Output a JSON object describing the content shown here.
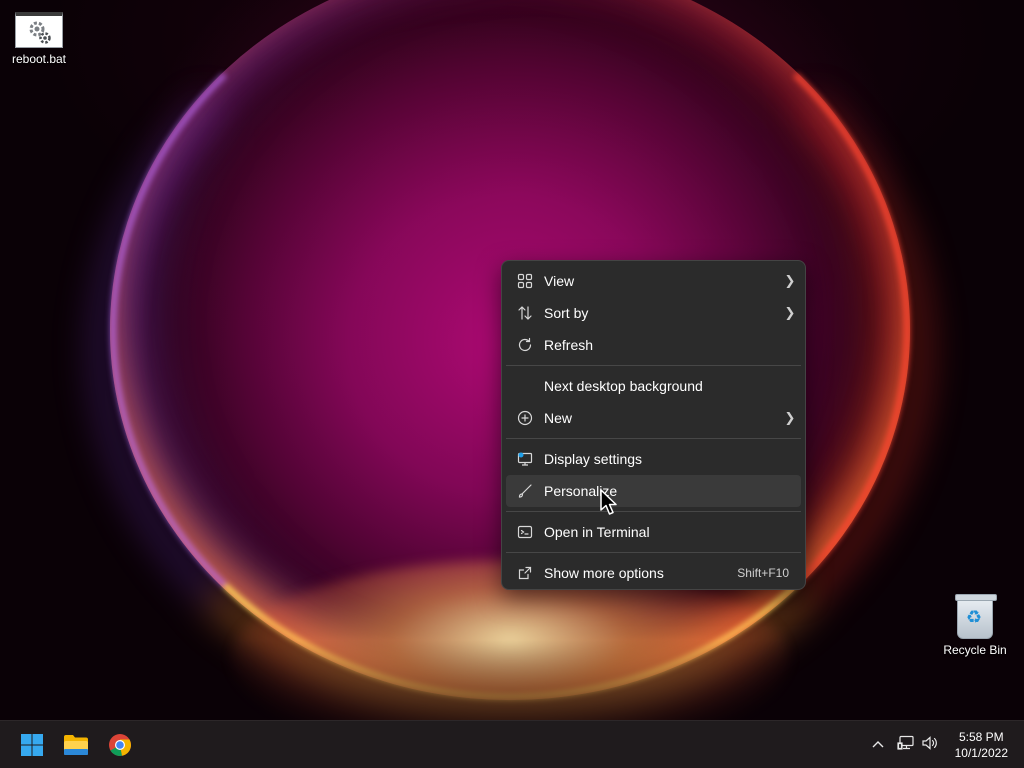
{
  "desktop": {
    "icons": [
      {
        "label": "reboot.bat",
        "icon": "batch-file-icon"
      },
      {
        "label": "Recycle Bin",
        "icon": "recycle-bin-icon"
      }
    ]
  },
  "context_menu": {
    "items": [
      {
        "label": "View",
        "icon": "view-grid-icon",
        "submenu": true
      },
      {
        "label": "Sort by",
        "icon": "sort-arrows-icon",
        "submenu": true
      },
      {
        "label": "Refresh",
        "icon": "refresh-icon"
      },
      {
        "label": "Next desktop background"
      },
      {
        "label": "New",
        "icon": "plus-circle-icon",
        "submenu": true
      },
      {
        "label": "Display settings",
        "icon": "display-icon"
      },
      {
        "label": "Personalize",
        "icon": "brush-icon",
        "hovered": true
      },
      {
        "label": "Open in Terminal",
        "icon": "terminal-icon"
      },
      {
        "label": "Show more options",
        "icon": "more-options-icon",
        "shortcut": "Shift+F10"
      }
    ]
  },
  "taskbar": {
    "apps": [
      {
        "name": "Start",
        "icon": "windows-start-icon"
      },
      {
        "name": "File Explorer",
        "icon": "folder-icon"
      },
      {
        "name": "Google Chrome",
        "icon": "chrome-icon"
      }
    ],
    "tray": {
      "icons": [
        "chevron-up-icon",
        "network-icon",
        "volume-icon"
      ],
      "time": "5:58 PM",
      "date": "10/1/2022"
    }
  },
  "colors": {
    "menu_bg": "#2b2b2b",
    "menu_hover": "#3a3a3a",
    "taskbar_bg": "#1f1b1d",
    "accent_blue": "#1f9fe8"
  }
}
